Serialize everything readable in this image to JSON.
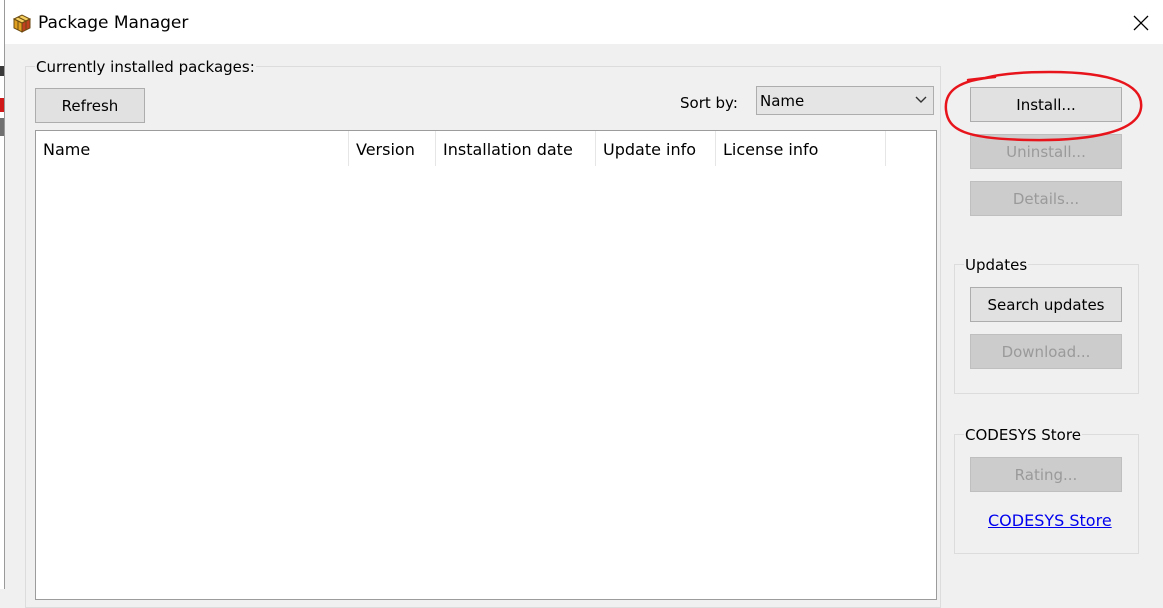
{
  "window": {
    "title": "Package Manager",
    "icon": "package-box-icon",
    "close_icon": "close-icon"
  },
  "installed": {
    "group_label": "Currently installed packages:",
    "refresh_label": "Refresh",
    "sort_label": "Sort by:",
    "sort_value": "Name",
    "columns": [
      "Name",
      "Version",
      "Installation date",
      "Update info",
      "License info"
    ],
    "rows": []
  },
  "actions": {
    "install_label": "Install...",
    "uninstall_label": "Uninstall...",
    "details_label": "Details..."
  },
  "updates": {
    "group_label": "Updates",
    "search_label": "Search updates",
    "download_label": "Download..."
  },
  "store": {
    "group_label": "CODESYS Store",
    "rating_label": "Rating...",
    "link_label": "CODESYS Store"
  },
  "colors": {
    "annotation": "#e8141c",
    "link": "#0000ee",
    "disabled_text": "#9a9a9a"
  }
}
